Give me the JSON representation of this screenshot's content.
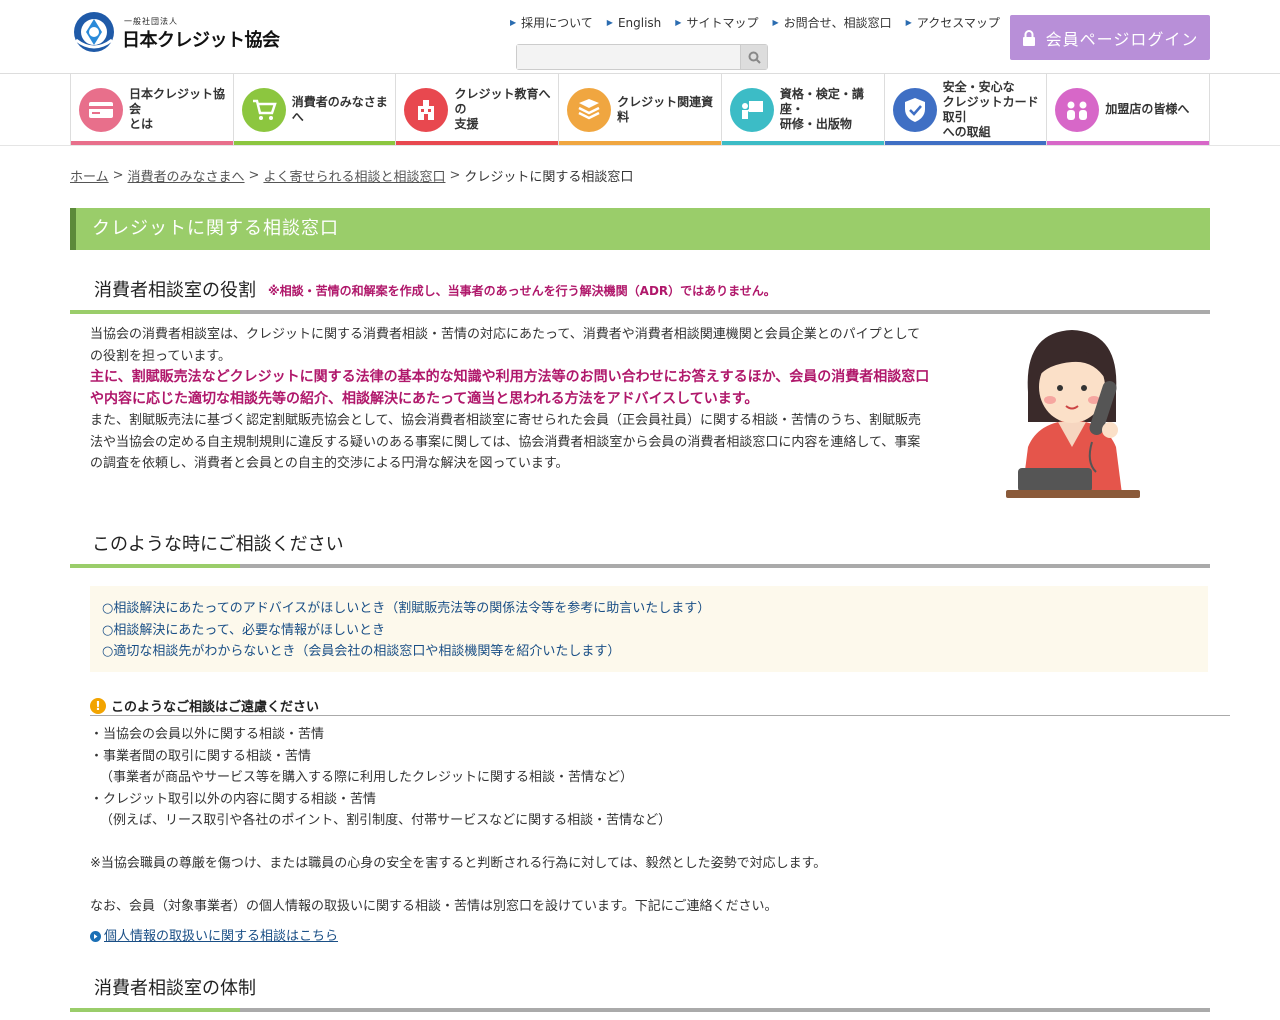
{
  "header": {
    "logo_sub": "一般社団法人",
    "logo_main": "日本クレジット協会",
    "utility_links": [
      "採用について",
      "English",
      "サイトマップ",
      "お問合せ、相談窓口",
      "アクセスマップ"
    ],
    "search_placeholder": "",
    "login_label": "会員ページログイン"
  },
  "nav": {
    "items": [
      {
        "label": "日本クレジット協会\nとは",
        "color": "#e86f8b"
      },
      {
        "label": "消費者のみなさまへ",
        "color": "#8cc63f"
      },
      {
        "label": "クレジット教育への\n支援",
        "color": "#e8484f"
      },
      {
        "label": "クレジット関連資料",
        "color": "#f0a640"
      },
      {
        "label": "資格・検定・講座・\n研修・出版物",
        "color": "#3cbcc6"
      },
      {
        "label": "安全・安心な\nクレジットカード取引\nへの取組",
        "color": "#3f6fc4"
      },
      {
        "label": "加盟店の皆様へ",
        "color": "#d767c8"
      }
    ]
  },
  "breadcrumb": {
    "home": "ホーム",
    "level1": "消費者のみなさまへ",
    "level2": "よく寄せられる相談と相談窓口",
    "current": "クレジットに関する相談窓口"
  },
  "page_title": "クレジットに関する相談窓口",
  "role_section": {
    "heading": "消費者相談室の役割",
    "note": "※相談・苦情の和解案を作成し、当事者のあっせんを行う解決機関（ADR）ではありません。",
    "p1": "当協会の消費者相談室は、クレジットに関する消費者相談・苦情の対応にあたって、消費者や消費者相談関連機関と会員企業とのパイプとしての役割を担っています。",
    "p2": "主に、割賦販売法などクレジットに関する法律の基本的な知識や利用方法等のお問い合わせにお答えするほか、会員の消費者相談窓口や内容に応じた適切な相談先等の紹介、相談解決にあたって適当と思われる方法をアドバイスしています。",
    "p3": "また、割賦販売法に基づく認定割賦販売協会として、協会消費者相談室に寄せられた会員（正会員社員）に関する相談・苦情のうち、割賦販売法や当協会の定める自主規制規則に違反する疑いのある事案に関しては、協会消費者相談室から会員の消費者相談窓口に内容を連絡して、事案の調査を依頼し、消費者と会員との自主的交渉による円滑な解決を図っています。"
  },
  "consult_section": {
    "heading": "このような時にご相談ください",
    "items": [
      "○相談解決にあたってのアドバイスがほしいとき（割賦販売法等の関係法令等を参考に助言いたします）",
      "○相談解決にあたって、必要な情報がほしいとき",
      "○適切な相談先がわからないとき（会員会社の相談窓口や相談機関等を紹介いたします）"
    ]
  },
  "caution": {
    "title": "このようなご相談はご遠慮ください",
    "items": [
      "・当協会の会員以外に関する相談・苦情",
      "・事業者間の取引に関する相談・苦情",
      "（事業者が商品やサービス等を購入する際に利用したクレジットに関する相談・苦情など）",
      "・クレジット取引以外の内容に関する相談・苦情",
      "（例えば、リース取引や各社のポイント、割引制度、付帯サービスなどに関する相談・苦情など）"
    ],
    "notice1": "※当協会職員の尊厳を傷つけ、または職員の心身の安全を害すると判断される行為に対しては、毅然とした姿勢で対応します。",
    "notice2": "なお、会員（対象事業者）の個人情報の取扱いに関する相談・苦情は別窓口を設けています。下記にご連絡ください。",
    "link": "個人情報の取扱いに関する相談はこちら"
  },
  "structure_section": {
    "heading": "消費者相談室の体制"
  }
}
